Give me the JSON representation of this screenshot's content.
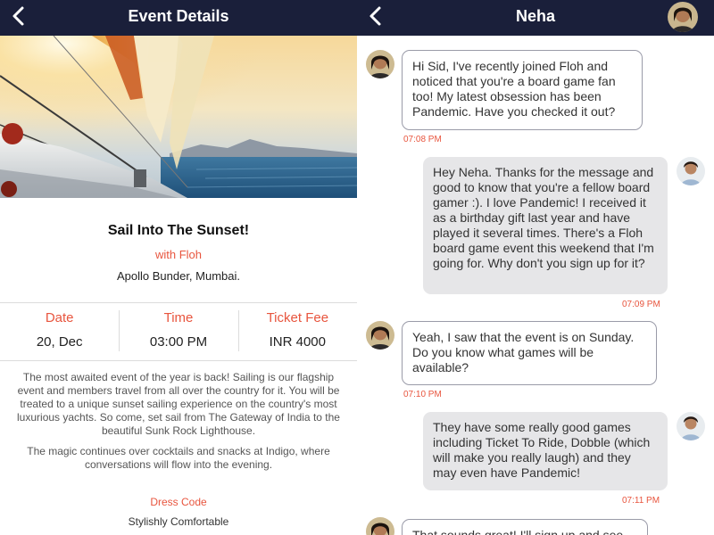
{
  "event_screen": {
    "header": {
      "title": "Event Details"
    },
    "event": {
      "title": "Sail Into The Sunset!",
      "host": "with Floh",
      "location": "Apollo Bunder, Mumbai."
    },
    "stats": [
      {
        "label": "Date",
        "value": "20, Dec"
      },
      {
        "label": "Time",
        "value": "03:00 PM"
      },
      {
        "label": "Ticket Fee",
        "value": "INR 4000"
      }
    ],
    "description": [
      "The most awaited event of the year is back! Sailing is our flagship event and members travel from all over the country for it. You will be treated to a unique sunset sailing experience on the country's most luxurious yachts. So come, set sail from The Gateway of India to the beautiful Sunk Rock Lighthouse.",
      "The magic continues over cocktails and snacks at Indigo, where conversations will flow into the evening."
    ],
    "dress_code": {
      "label": "Dress Code",
      "value": "Stylishly Comfortable"
    }
  },
  "chat_screen": {
    "header": {
      "title": "Neha"
    },
    "messages": [
      {
        "direction": "incoming",
        "text": "Hi Sid, I've recently joined Floh and noticed that you're a board game fan too! My latest obsession has been Pandemic. Have you checked it out?",
        "time": "07:08 PM"
      },
      {
        "direction": "outgoing",
        "text": "Hey Neha. Thanks for the message and good to know that you're a fellow board gamer :). I love Pandemic! I received it as a birthday gift last year and have played it several times. There's a Floh board game event this weekend that I'm going for. Why don't you sign up for it?",
        "time": "07:09 PM"
      },
      {
        "direction": "incoming",
        "text": "Yeah, I saw that the event is on Sunday. Do you know what games will be available?",
        "time": "07:10 PM"
      },
      {
        "direction": "outgoing",
        "text": "They have some really good games including Ticket To Ride, Dobble (which will make you really laugh) and they may even have Pandemic!",
        "time": "07:11 PM"
      },
      {
        "direction": "incoming",
        "text": "That sounds great! I'll sign up and see",
        "time": ""
      }
    ]
  },
  "colors": {
    "header_bg": "#1a1f3a",
    "accent": "#e8553e",
    "incoming_border": "#9a9ba8",
    "outgoing_bg": "#e6e6e8"
  }
}
